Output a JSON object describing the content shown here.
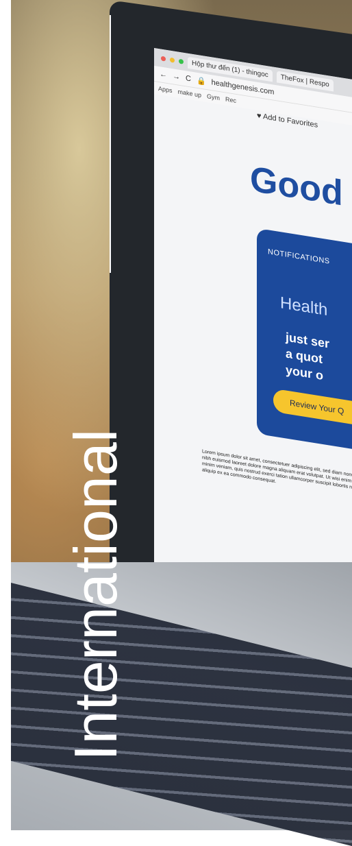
{
  "overlay": {
    "title": "International"
  },
  "browser": {
    "tabs": [
      "Hộp thư đến (1) - thingoc",
      "TheFox | Respo"
    ],
    "url": "healthgenesis.com",
    "bookmarks": [
      "Apps",
      "make up",
      "Gym",
      "Rec"
    ],
    "favorites": "Add to Favorites"
  },
  "webpage": {
    "headline": "Good",
    "card_label": "NOTIFICATIONS",
    "brand": "Health",
    "message_lines": [
      "just ser",
      "a quot",
      "your o"
    ],
    "button_label": "Review Your Q",
    "lorem": "Lorem ipsum dolor sit amet, consectetuer adipiscing elit, sed diam nonummy nibh euismod laoreet dolore magna aliquam erat volutpat. Ut wisi enim ad minim veniam, quis nostrud exerci tation ullamcorper suscipit lobortis nisl ut aliquip ex ea commodo consequat."
  },
  "colors": {
    "accent": "#1c4a9c",
    "button": "#f6c52d",
    "overlay_text": "#ffffff"
  }
}
